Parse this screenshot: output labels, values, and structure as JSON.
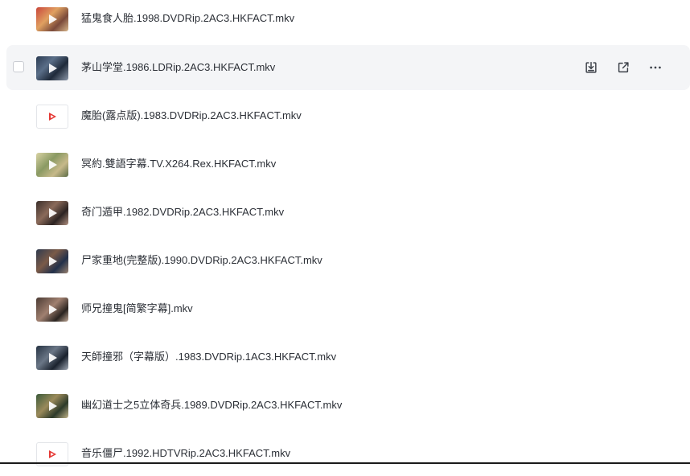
{
  "files": [
    {
      "name": "猛鬼食人胎.1998.DVDRip.2AC3.HKFACT.mkv",
      "thumbnail": "video-frame",
      "selected": false
    },
    {
      "name": "茅山学堂.1986.LDRip.2AC3.HKFACT.mkv",
      "thumbnail": "video-frame",
      "selected": true
    },
    {
      "name": "魔胎(露点版).1983.DVDRip.2AC3.HKFACT.mkv",
      "thumbnail": "video-file-icon",
      "selected": false
    },
    {
      "name": "冥約.雙語字幕.TV.X264.Rex.HKFACT.mkv",
      "thumbnail": "video-frame",
      "selected": false
    },
    {
      "name": "奇门遁甲.1982.DVDRip.2AC3.HKFACT.mkv",
      "thumbnail": "video-frame",
      "selected": false
    },
    {
      "name": "尸家重地(完整版).1990.DVDRip.2AC3.HKFACT.mkv",
      "thumbnail": "video-frame",
      "selected": false
    },
    {
      "name": "师兄撞鬼[简繁字幕].mkv",
      "thumbnail": "video-frame",
      "selected": false
    },
    {
      "name": "天師撞邪（字幕版）.1983.DVDRip.1AC3.HKFACT.mkv",
      "thumbnail": "video-frame",
      "selected": false
    },
    {
      "name": "幽幻道士之5立体奇兵.1989.DVDRip.2AC3.HKFACT.mkv",
      "thumbnail": "video-frame",
      "selected": false
    },
    {
      "name": "音乐僵尸.1992.HDTVRip.2AC3.HKFACT.mkv",
      "thumbnail": "video-file-icon",
      "selected": false
    }
  ],
  "row_actions": [
    {
      "icon": "download-icon"
    },
    {
      "icon": "share-icon"
    },
    {
      "icon": "more-icon"
    }
  ],
  "colors": {
    "selected_row_bg": "#f4f5f7",
    "text": "#2b2f36",
    "video_icon_accent": "#e53935",
    "action_icon": "#3a3f47"
  }
}
